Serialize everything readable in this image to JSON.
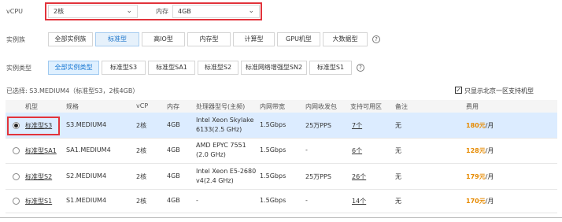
{
  "vcpu": {
    "label": "vCPU",
    "cpu_value": "2核",
    "mem_label": "内存",
    "mem_value": "4GB"
  },
  "family": {
    "label": "实例族",
    "options": [
      "全部实例族",
      "标准型",
      "高IO型",
      "内存型",
      "计算型",
      "GPU机型",
      "大数据型"
    ],
    "selected": "标准型"
  },
  "type": {
    "label": "实例类型",
    "options": [
      "全部实例类型",
      "标准型S3",
      "标准型SA1",
      "标准型S2",
      "标准网络增强型SN2",
      "标准型S1"
    ],
    "selected": "全部实例类型"
  },
  "selected_summary": "已选择: S3.MEDIUM4（标准型S3，2核4GB）",
  "filter_checkbox": {
    "label": "只显示北京一区支持机型",
    "checked": true
  },
  "table": {
    "headers": [
      "机型",
      "规格",
      "vCP",
      "内存",
      "处理器型号(主频)",
      "内网带宽",
      "内网收发包",
      "支持可用区",
      "备注",
      "费用"
    ],
    "rows": [
      {
        "model": "标准型S3",
        "spec": "S3.MEDIUM4",
        "vcpu": "2核",
        "mem": "4GB",
        "cpu_l1": "Intel Xeon Skylake",
        "cpu_l2": "6133(2.5 GHz)",
        "bw": "1.5Gbps",
        "pps": "25万PPS",
        "zones": "7个",
        "note": "无",
        "price": "180元",
        "unit": "/月",
        "selected": true
      },
      {
        "model": "标准型SA1",
        "spec": "SA1.MEDIUM4",
        "vcpu": "2核",
        "mem": "4GB",
        "cpu_l1": "AMD EPYC 7551",
        "cpu_l2": "(2.0 GHz)",
        "bw": "1.5Gbps",
        "pps": "-",
        "zones": "6个",
        "note": "无",
        "price": "128元",
        "unit": "/月",
        "selected": false
      },
      {
        "model": "标准型S2",
        "spec": "S2.MEDIUM4",
        "vcpu": "2核",
        "mem": "4GB",
        "cpu_l1": "Intel Xeon E5-2680",
        "cpu_l2": "v4(2.4 GHz)",
        "bw": "1.5Gbps",
        "pps": "25万PPS",
        "zones": "26个",
        "note": "无",
        "price": "179元",
        "unit": "/月",
        "selected": false
      },
      {
        "model": "标准型S1",
        "spec": "S1.MEDIUM4",
        "vcpu": "2核",
        "mem": "4GB",
        "cpu_l1": "-",
        "cpu_l2": "",
        "bw": "1.5Gbps",
        "pps": "-",
        "zones": "14个",
        "note": "无",
        "price": "170元",
        "unit": "/月",
        "selected": false
      }
    ]
  },
  "colors": {
    "highlight": "#e2333b",
    "accent": "#1a73c9",
    "price": "#e68a00",
    "selected_row": "#dcecff"
  }
}
